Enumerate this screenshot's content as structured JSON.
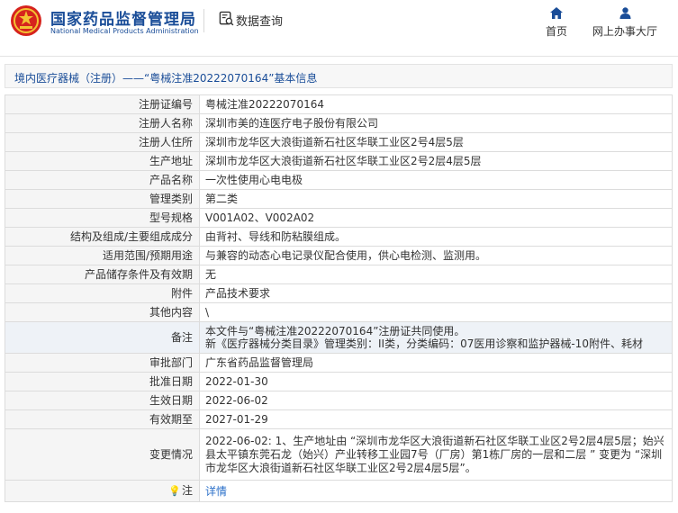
{
  "header": {
    "brand_cn": "国家药品监督管理局",
    "brand_en": "National Medical Products Administration",
    "data_query": "数据查询",
    "nav_home": "首页",
    "nav_office": "网上办事大厅"
  },
  "title": "境内医疗器械（注册）——“粤械注准20222070164”基本信息",
  "rows": [
    {
      "label": "注册证编号",
      "value": "粤械注准20222070164"
    },
    {
      "label": "注册人名称",
      "value": "深圳市美的连医疗电子股份有限公司"
    },
    {
      "label": "注册人住所",
      "value": "深圳市龙华区大浪街道新石社区华联工业区2号4层5层"
    },
    {
      "label": "生产地址",
      "value": "深圳市龙华区大浪街道新石社区华联工业区2号2层4层5层"
    },
    {
      "label": "产品名称",
      "value": "一次性使用心电电极"
    },
    {
      "label": "管理类别",
      "value": "第二类"
    },
    {
      "label": "型号规格",
      "value": "V001A02、V002A02"
    },
    {
      "label": "结构及组成/主要组成成分",
      "value": "由背衬、导线和防粘膜组成。"
    },
    {
      "label": "适用范围/预期用途",
      "value": "与兼容的动态心电记录仪配合使用，供心电检测、监测用。"
    },
    {
      "label": "产品储存条件及有效期",
      "value": "无"
    },
    {
      "label": "附件",
      "value": "产品技术要求"
    },
    {
      "label": "其他内容",
      "value": "\\"
    },
    {
      "label": "备注",
      "value_line1": "本文件与“粤械注准20222070164”注册证共同使用。",
      "value_line2": "新《医疗器械分类目录》管理类别：II类，分类编码：07医用诊察和监护器械-10附件、耗材"
    },
    {
      "label": "审批部门",
      "value": "广东省药品监督管理局"
    },
    {
      "label": "批准日期",
      "value": "2022-01-30"
    },
    {
      "label": "生效日期",
      "value": "2022-06-02"
    },
    {
      "label": "有效期至",
      "value": "2027-01-29"
    },
    {
      "label": "变更情况",
      "value": "2022-06-02: 1、生产地址由 “深圳市龙华区大浪街道新石社区华联工业区2号2层4层5层；始兴县太平镇东莞石龙（始兴）产业转移工业园7号（厂房）第1栋厂房的一层和二层 ” 变更为 “深圳市龙华区大浪街道新石社区华联工业区2号2层4层5层”。"
    },
    {
      "label": "注",
      "value": "详情"
    }
  ]
}
